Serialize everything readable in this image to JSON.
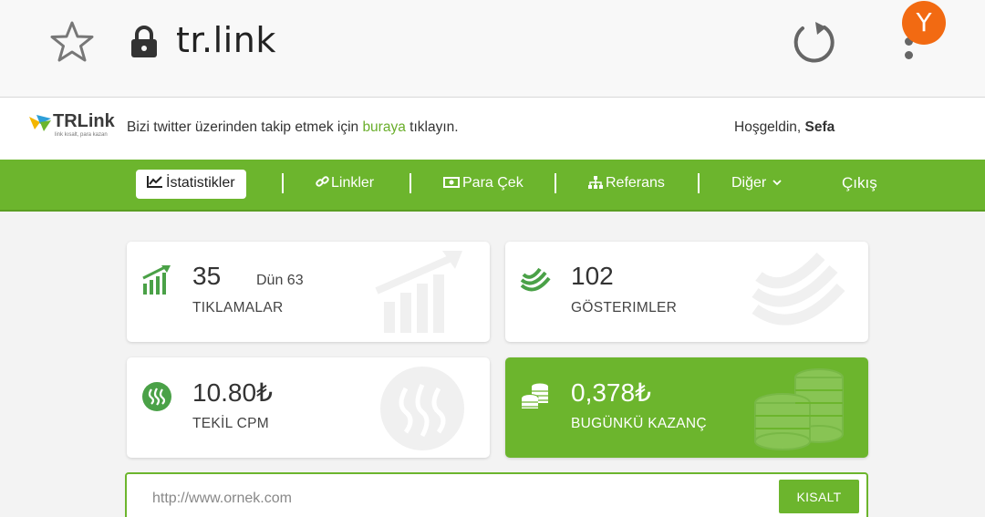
{
  "browser": {
    "url": "tr.link",
    "avatar_letter": "Y",
    "avatar_color": "#f26a12"
  },
  "header": {
    "logo_text": "TRLink",
    "logo_sub": "link kısalt, para kazan",
    "tagline_before": "Bizi twitter üzerinden takip etmek için ",
    "tagline_link": "buraya",
    "tagline_after": " tıklayın.",
    "welcome_prefix": "Hoşgeldin, ",
    "welcome_name": "Sefa"
  },
  "nav": {
    "items": [
      {
        "label": "İstatistikler",
        "icon": "chart-line-icon",
        "active": true
      },
      {
        "label": "Linkler",
        "icon": "link-icon"
      },
      {
        "label": "Para Çek",
        "icon": "money-icon"
      },
      {
        "label": "Referans",
        "icon": "sitemap-icon"
      },
      {
        "label": "Diğer",
        "icon": "chevron-down-icon"
      },
      {
        "label": "Çıkış"
      }
    ]
  },
  "stats": {
    "clicks": {
      "value": "35",
      "yesterday": "Dün 63",
      "label": "TIKLAMALAR",
      "icon": "bar-chart-icon"
    },
    "views": {
      "value": "102",
      "label": "GÖSTERIMLER",
      "icon": "views-icon"
    },
    "cpm": {
      "value": "10.80₺",
      "label": "TEKİL CPM",
      "icon": "steem-icon"
    },
    "earnings": {
      "value": "0,378₺",
      "label": "BUGÜNKÜ KAZANÇ",
      "icon": "coins-icon"
    }
  },
  "shortener": {
    "placeholder": "http://www.ornek.com",
    "button_label": "KISALT"
  },
  "colors": {
    "accent": "#6cb52d",
    "link": "#6aae2b"
  }
}
